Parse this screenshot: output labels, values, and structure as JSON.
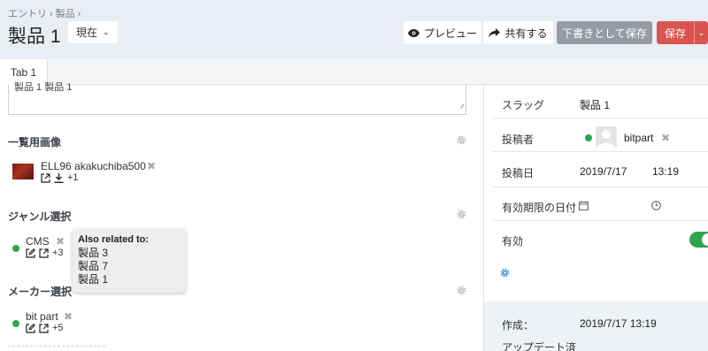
{
  "breadcrumb": [
    "エントリ",
    "製品"
  ],
  "breadcrumb_sep": "›",
  "page_title": "製品 1",
  "version_select": "現在",
  "toolbar": {
    "preview_label": "プレビュー",
    "share_label": "共有する",
    "draft_label": "下書きとして保存",
    "save_label": "保存"
  },
  "tabs": [
    {
      "label": "Tab 1"
    }
  ],
  "main": {
    "textarea_value": "製品 1 製品 1",
    "sections": {
      "list_image": {
        "title": "一覧用画像",
        "item_name": "ELL96 akakuchiba500",
        "extra_count": "+1"
      },
      "genre": {
        "title": "ジャンル選択",
        "item_name": "CMS",
        "extra_count": "+3"
      },
      "maker": {
        "title": "メーカー選択",
        "item_name": "bit part",
        "extra_count": "+5"
      }
    }
  },
  "tooltip": {
    "title": "Also related to:",
    "items": [
      "製品 3",
      "製品 7",
      "製品 1"
    ]
  },
  "sidebar": {
    "slug_label": "スラッグ",
    "slug_value": "製品 1",
    "author_label": "投稿者",
    "author_value": "bitpart",
    "post_date_label": "投稿日",
    "post_date": "2019/7/17",
    "post_time": "13:19",
    "expiry_label": "有効期限の日付",
    "enabled_label": "有効",
    "enabled": true,
    "created_label": "作成：",
    "created_value": "2019/7/17 13:19",
    "updated_label": "アップデート済"
  },
  "colors": {
    "header_bg": "#e9eef4",
    "save_red": "#d9534f",
    "draft_gray": "#959ca4",
    "green": "#2ea44f",
    "link_blue": "#4a90d9"
  }
}
